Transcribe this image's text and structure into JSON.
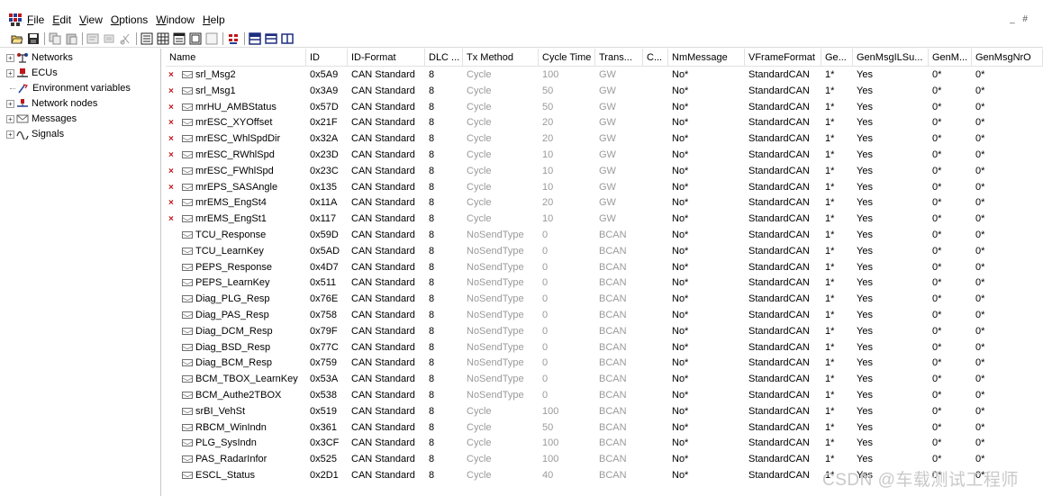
{
  "menubar": {
    "items": [
      "File",
      "Edit",
      "View",
      "Options",
      "Window",
      "Help"
    ],
    "mnemonics": [
      "F",
      "E",
      "V",
      "O",
      "W",
      "H"
    ]
  },
  "window_controls": "_ #",
  "toolbar": {
    "icons": [
      "open-icon",
      "save-icon",
      "copy-icon",
      "paste-icon",
      "properties-icon",
      "properties2-icon",
      "cut-icon",
      "view-list-icon",
      "view-grid-icon",
      "view-details-icon",
      "view-tree-icon",
      "view-blank-icon",
      "filter-icon",
      "tile-vertical-icon",
      "tile-horizontal-icon",
      "split-icon"
    ]
  },
  "tree": {
    "items": [
      {
        "label": "Networks",
        "icon": "network-icon",
        "expandable": true
      },
      {
        "label": "ECUs",
        "icon": "ecu-icon",
        "expandable": true
      },
      {
        "label": "Environment variables",
        "icon": "env-variable-icon",
        "expandable": false
      },
      {
        "label": "Network nodes",
        "icon": "network-node-icon",
        "expandable": true
      },
      {
        "label": "Messages",
        "icon": "message-icon",
        "expandable": true
      },
      {
        "label": "Signals",
        "icon": "signal-icon",
        "expandable": true
      }
    ]
  },
  "table": {
    "columns": [
      "Name",
      "ID",
      "ID-Format",
      "DLC ...",
      "Tx Method",
      "Cycle Time",
      "Trans...",
      "C...",
      "NmMessage",
      "VFrameFormat",
      "Ge...",
      "GenMsgILSu...",
      "GenM...",
      "GenMsgNrO"
    ],
    "rows": [
      {
        "marked": true,
        "cells": [
          "srl_Msg2",
          "0x5A9",
          "CAN Standard",
          "8",
          "Cycle",
          "100",
          "GW",
          "",
          "No*",
          "StandardCAN",
          "1*",
          "Yes",
          "0*",
          "0*"
        ]
      },
      {
        "marked": true,
        "cells": [
          "srl_Msg1",
          "0x3A9",
          "CAN Standard",
          "8",
          "Cycle",
          "50",
          "GW",
          "",
          "No*",
          "StandardCAN",
          "1*",
          "Yes",
          "0*",
          "0*"
        ]
      },
      {
        "marked": true,
        "cells": [
          "mrHU_AMBStatus",
          "0x57D",
          "CAN Standard",
          "8",
          "Cycle",
          "50",
          "GW",
          "",
          "No*",
          "StandardCAN",
          "1*",
          "Yes",
          "0*",
          "0*"
        ]
      },
      {
        "marked": true,
        "cells": [
          "mrESC_XYOffset",
          "0x21F",
          "CAN Standard",
          "8",
          "Cycle",
          "20",
          "GW",
          "",
          "No*",
          "StandardCAN",
          "1*",
          "Yes",
          "0*",
          "0*"
        ]
      },
      {
        "marked": true,
        "cells": [
          "mrESC_WhlSpdDir",
          "0x32A",
          "CAN Standard",
          "8",
          "Cycle",
          "20",
          "GW",
          "",
          "No*",
          "StandardCAN",
          "1*",
          "Yes",
          "0*",
          "0*"
        ]
      },
      {
        "marked": true,
        "cells": [
          "mrESC_RWhlSpd",
          "0x23D",
          "CAN Standard",
          "8",
          "Cycle",
          "10",
          "GW",
          "",
          "No*",
          "StandardCAN",
          "1*",
          "Yes",
          "0*",
          "0*"
        ]
      },
      {
        "marked": true,
        "cells": [
          "mrESC_FWhlSpd",
          "0x23C",
          "CAN Standard",
          "8",
          "Cycle",
          "10",
          "GW",
          "",
          "No*",
          "StandardCAN",
          "1*",
          "Yes",
          "0*",
          "0*"
        ]
      },
      {
        "marked": true,
        "cells": [
          "mrEPS_SASAngle",
          "0x135",
          "CAN Standard",
          "8",
          "Cycle",
          "10",
          "GW",
          "",
          "No*",
          "StandardCAN",
          "1*",
          "Yes",
          "0*",
          "0*"
        ]
      },
      {
        "marked": true,
        "cells": [
          "mrEMS_EngSt4",
          "0x11A",
          "CAN Standard",
          "8",
          "Cycle",
          "20",
          "GW",
          "",
          "No*",
          "StandardCAN",
          "1*",
          "Yes",
          "0*",
          "0*"
        ]
      },
      {
        "marked": true,
        "cells": [
          "mrEMS_EngSt1",
          "0x117",
          "CAN Standard",
          "8",
          "Cycle",
          "10",
          "GW",
          "",
          "No*",
          "StandardCAN",
          "1*",
          "Yes",
          "0*",
          "0*"
        ]
      },
      {
        "marked": false,
        "cells": [
          "TCU_Response",
          "0x59D",
          "CAN Standard",
          "8",
          "NoSendType",
          "0",
          "BCAN",
          "",
          "No*",
          "StandardCAN",
          "1*",
          "Yes",
          "0*",
          "0*"
        ]
      },
      {
        "marked": false,
        "cells": [
          "TCU_LearnKey",
          "0x5AD",
          "CAN Standard",
          "8",
          "NoSendType",
          "0",
          "BCAN",
          "",
          "No*",
          "StandardCAN",
          "1*",
          "Yes",
          "0*",
          "0*"
        ]
      },
      {
        "marked": false,
        "cells": [
          "PEPS_Response",
          "0x4D7",
          "CAN Standard",
          "8",
          "NoSendType",
          "0",
          "BCAN",
          "",
          "No*",
          "StandardCAN",
          "1*",
          "Yes",
          "0*",
          "0*"
        ]
      },
      {
        "marked": false,
        "cells": [
          "PEPS_LearnKey",
          "0x511",
          "CAN Standard",
          "8",
          "NoSendType",
          "0",
          "BCAN",
          "",
          "No*",
          "StandardCAN",
          "1*",
          "Yes",
          "0*",
          "0*"
        ]
      },
      {
        "marked": false,
        "cells": [
          "Diag_PLG_Resp",
          "0x76E",
          "CAN Standard",
          "8",
          "NoSendType",
          "0",
          "BCAN",
          "",
          "No*",
          "StandardCAN",
          "1*",
          "Yes",
          "0*",
          "0*"
        ]
      },
      {
        "marked": false,
        "cells": [
          "Diag_PAS_Resp",
          "0x758",
          "CAN Standard",
          "8",
          "NoSendType",
          "0",
          "BCAN",
          "",
          "No*",
          "StandardCAN",
          "1*",
          "Yes",
          "0*",
          "0*"
        ]
      },
      {
        "marked": false,
        "cells": [
          "Diag_DCM_Resp",
          "0x79F",
          "CAN Standard",
          "8",
          "NoSendType",
          "0",
          "BCAN",
          "",
          "No*",
          "StandardCAN",
          "1*",
          "Yes",
          "0*",
          "0*"
        ]
      },
      {
        "marked": false,
        "cells": [
          "Diag_BSD_Resp",
          "0x77C",
          "CAN Standard",
          "8",
          "NoSendType",
          "0",
          "BCAN",
          "",
          "No*",
          "StandardCAN",
          "1*",
          "Yes",
          "0*",
          "0*"
        ]
      },
      {
        "marked": false,
        "cells": [
          "Diag_BCM_Resp",
          "0x759",
          "CAN Standard",
          "8",
          "NoSendType",
          "0",
          "BCAN",
          "",
          "No*",
          "StandardCAN",
          "1*",
          "Yes",
          "0*",
          "0*"
        ]
      },
      {
        "marked": false,
        "cells": [
          "BCM_TBOX_LearnKey",
          "0x53A",
          "CAN Standard",
          "8",
          "NoSendType",
          "0",
          "BCAN",
          "",
          "No*",
          "StandardCAN",
          "1*",
          "Yes",
          "0*",
          "0*"
        ]
      },
      {
        "marked": false,
        "cells": [
          "BCM_Authe2TBOX",
          "0x538",
          "CAN Standard",
          "8",
          "NoSendType",
          "0",
          "BCAN",
          "",
          "No*",
          "StandardCAN",
          "1*",
          "Yes",
          "0*",
          "0*"
        ]
      },
      {
        "marked": false,
        "cells": [
          "srBI_VehSt",
          "0x519",
          "CAN Standard",
          "8",
          "Cycle",
          "100",
          "BCAN",
          "",
          "No*",
          "StandardCAN",
          "1*",
          "Yes",
          "0*",
          "0*"
        ]
      },
      {
        "marked": false,
        "cells": [
          "RBCM_WinIndn",
          "0x361",
          "CAN Standard",
          "8",
          "Cycle",
          "50",
          "BCAN",
          "",
          "No*",
          "StandardCAN",
          "1*",
          "Yes",
          "0*",
          "0*"
        ]
      },
      {
        "marked": false,
        "cells": [
          "PLG_SysIndn",
          "0x3CF",
          "CAN Standard",
          "8",
          "Cycle",
          "100",
          "BCAN",
          "",
          "No*",
          "StandardCAN",
          "1*",
          "Yes",
          "0*",
          "0*"
        ]
      },
      {
        "marked": false,
        "cells": [
          "PAS_RadarInfor",
          "0x525",
          "CAN Standard",
          "8",
          "Cycle",
          "100",
          "BCAN",
          "",
          "No*",
          "StandardCAN",
          "1*",
          "Yes",
          "0*",
          "0*"
        ]
      },
      {
        "marked": false,
        "cells": [
          "ESCL_Status",
          "0x2D1",
          "CAN Standard",
          "8",
          "Cycle",
          "40",
          "BCAN",
          "",
          "No*",
          "StandardCAN",
          "1*",
          "Yes",
          "0*",
          "0*"
        ]
      }
    ]
  },
  "watermark": "CSDN @车载测试工程师",
  "colors": {
    "mark_red": "#c0161b",
    "muted_gray": "#9a9a9a",
    "grid_line": "#e2e2e2"
  }
}
